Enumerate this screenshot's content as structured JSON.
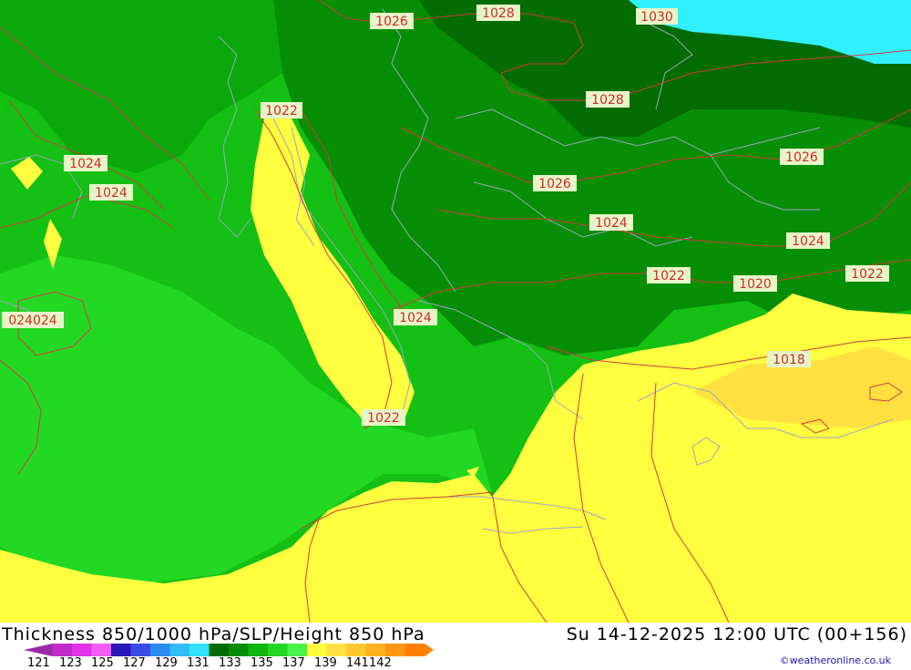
{
  "map": {
    "isobar_labels": [
      "1030",
      "1028",
      "1026",
      "1024",
      "1022",
      "1020",
      "1018",
      "024024"
    ]
  },
  "footer": {
    "title": "Thickness 850/1000 hPa/SLP/Height 850 hPa",
    "datetime": "Su 14-12-2025 12:00 UTC (00+156)",
    "copyright": "©weatheronline.co.uk"
  },
  "legend": {
    "values": [
      "121",
      "123",
      "125",
      "127",
      "129",
      "131",
      "133",
      "135",
      "137",
      "139",
      "141",
      "142"
    ],
    "colors": [
      "#9a2aa8",
      "#c12cc8",
      "#e034e6",
      "#f25cf2",
      "#2a18b8",
      "#3a4ce8",
      "#2a8cf0",
      "#30bcf6",
      "#32e2f8",
      "#036c03",
      "#078e07",
      "#10b510",
      "#22d822",
      "#48f248",
      "#ffff40",
      "#ffe040",
      "#ffc830",
      "#ffb020",
      "#ff9810",
      "#ff8000"
    ]
  }
}
